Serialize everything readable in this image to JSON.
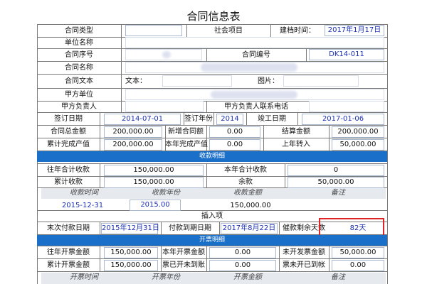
{
  "page_title": "合同信息表",
  "row1": {
    "contract_type_label": "合同类型",
    "contract_type_value": "",
    "category": "社会项目",
    "filing_time_label": "建档时间：",
    "filing_time_value": "2017年1月17日"
  },
  "row2": {
    "unit_name_label": "单位名称"
  },
  "row3": {
    "serial_label": "合同序号",
    "number_label": "合同编号",
    "number_value": "DK14-011"
  },
  "row4": {
    "name_label": "合同名称"
  },
  "row5": {
    "text_label": "合同文本",
    "text_field_label": "文本：",
    "image_label": "图片："
  },
  "row6": {
    "party_a_label": "甲方单位"
  },
  "row7": {
    "party_a_person_label": "甲方负责人",
    "party_a_contact_label": "甲方负责人联系电话"
  },
  "row8": {
    "sign_date_label": "签订日期",
    "sign_date_value": "2014-07-01",
    "sign_year_label": "签订年份",
    "sign_year_value": "2014",
    "completion_label": "竣工日期",
    "completion_value": "2017-01-06"
  },
  "row9": {
    "total_label": "合同总金额",
    "total_value": "200,000.00",
    "added_label": "新增合同额",
    "added_value": "0.00",
    "settle_label": "结算金额",
    "settle_value": "200,000.00"
  },
  "row10": {
    "cum_label": "累计完成产值",
    "cum_value": "200,000.00",
    "year_label": "本年完成产值",
    "year_value": "0.00",
    "prev_label": "上年转入",
    "prev_value": "50,000.00"
  },
  "receipts_header": "收款明细",
  "row11": {
    "past_label": "往年合计收款",
    "past_value": "150,000.00",
    "this_label": "本年合计收款",
    "this_value": "0"
  },
  "row12": {
    "cum_label": "累计收款",
    "cum_value": "150,000.00",
    "bal_label": "余款",
    "bal_value": "50,000.00"
  },
  "receipts_sub": {
    "time": "收款时间",
    "year": "收款年份",
    "amount": "收款金额",
    "note": "备注"
  },
  "receipt_row": {
    "time": "2015-12-31",
    "year": "2015.00",
    "amount": "150,000.00",
    "note": ""
  },
  "insert_label": "插入项",
  "row13": {
    "last_pay_label": "末次付款日期",
    "last_pay_value": "2015年12月31日",
    "due_label": "付款到期日期",
    "due_value": "2017年8月22日",
    "remain_label": "催款剩余天数",
    "remain_value": "82天"
  },
  "invoice_header": "开票明细",
  "row14": {
    "past_label": "往年开票金额",
    "past_value": "150,000.00",
    "this_label": "本年开票金额",
    "this_value": "0.00",
    "unbilled_label": "未开发票金额",
    "unbilled_value": "50,000.00"
  },
  "row15": {
    "cum_label": "累计开票金额",
    "cum_value": "150,000.00",
    "unpaid_label": "票已开未到账",
    "unpaid_value": "0.00",
    "paid_label": "票未开已到帐",
    "paid_value": "0.00"
  },
  "invoice_sub": {
    "time": "开票时间",
    "year": "开票年份",
    "amount": "开票金额",
    "note": "备注"
  }
}
